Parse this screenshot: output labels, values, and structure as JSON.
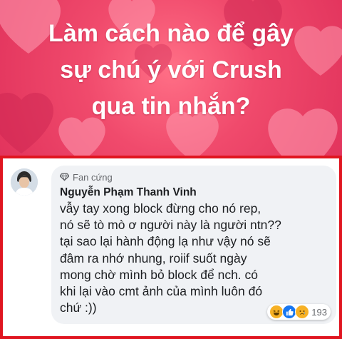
{
  "banner": {
    "title_line1": "Làm cách nào để gây",
    "title_line2": "sự chú ý với Crush",
    "title_line3": "qua tin nhắn?",
    "colors": {
      "background": "#ea4264",
      "heart_light": "#ff9fb4",
      "heart_dark": "#c9234f"
    }
  },
  "comment": {
    "badge": "Fan cứng",
    "badge_icon": "diamond-icon",
    "author": "Nguyễn Phạm Thanh Vinh",
    "text": "vẫy tay xong block đừng cho nó rep,\nnó sẽ tò mò ơ người này là người ntn??\ntại sao lại hành động lạ như vậy nó sẽ\nđâm ra nhớ nhung, roiif suốt ngày\nmong chờ mình bỏ block để nch. có\nkhi lại vào cmt ảnh của mình luôn đó\nchứ :))",
    "reactions": {
      "icons": [
        "haha-icon",
        "like-icon",
        "sad-icon"
      ],
      "count": "193"
    }
  },
  "frame_color": "#e01520"
}
